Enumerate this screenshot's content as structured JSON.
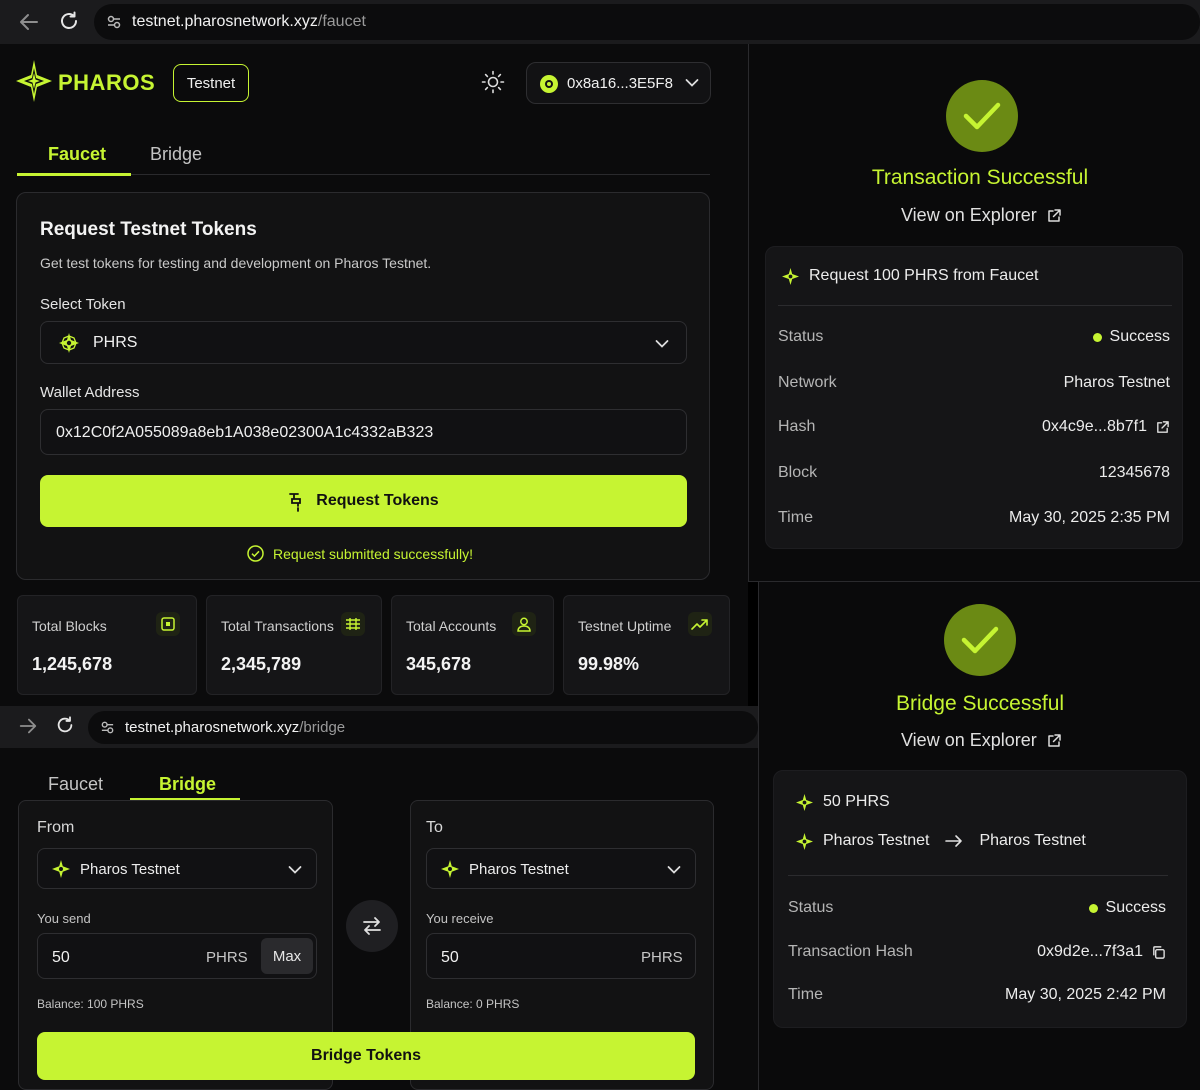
{
  "faucet_browser": {
    "url_host": "testnet.pharosnetwork.xyz",
    "url_path": "/faucet"
  },
  "header": {
    "brand": "PHAROS",
    "network_badge": "Testnet",
    "wallet_address": "0x8a16...3E5F8"
  },
  "faucet_tabs": {
    "faucet": "Faucet",
    "bridge": "Bridge",
    "active": "Faucet"
  },
  "request_card": {
    "title": "Request Testnet Tokens",
    "subtitle": "Get test tokens for testing and development on Pharos Testnet.",
    "select_label": "Select Token",
    "selected_token": "PHRS",
    "wallet_label": "Wallet Address",
    "wallet_value": "0x12C0f2A055089a8eb1A038e02300A1c4332aB323",
    "button_label": "Request Tokens",
    "success_message": "Request submitted successfully!"
  },
  "stats": [
    {
      "label": "Total Blocks",
      "value": "1,245,678",
      "icon": "block-icon"
    },
    {
      "label": "Total Transactions",
      "value": "2,345,789",
      "icon": "transactions-icon"
    },
    {
      "label": "Total Accounts",
      "value": "345,678",
      "icon": "user-icon"
    },
    {
      "label": "Testnet Uptime",
      "value": "99.98%",
      "icon": "trend-up-icon"
    }
  ],
  "tx_modal": {
    "title": "Transaction Successful",
    "explorer_link": "View on Explorer",
    "summary": "Request 100 PHRS from Faucet",
    "rows": [
      {
        "key": "Status",
        "value": "Success"
      },
      {
        "key": "Network",
        "value": "Pharos Testnet"
      },
      {
        "key": "Hash",
        "value": "0x4c9e...8b7f1"
      },
      {
        "key": "Block",
        "value": "12345678"
      },
      {
        "key": "Time",
        "value": "May 30, 2025 2:35 PM"
      }
    ]
  },
  "bridge_browser": {
    "url_host": "testnet.pharosnetwork.xyz",
    "url_path": "/bridge"
  },
  "bridge_tabs": {
    "faucet": "Faucet",
    "bridge": "Bridge",
    "active": "Bridge"
  },
  "bridge_form": {
    "from_label": "From",
    "from_network": "Pharos Testnet",
    "you_send_label": "You send",
    "send_amount": "50",
    "send_unit": "PHRS",
    "max_label": "Max",
    "send_balance": "Balance: 100 PHRS",
    "to_label": "To",
    "to_network": "Pharos Testnet",
    "you_receive_label": "You receive",
    "receive_amount": "50",
    "receive_unit": "PHRS",
    "receive_balance": "Balance: 0 PHRS",
    "button_label": "Bridge Tokens"
  },
  "bridge_modal": {
    "title": "Bridge Successful",
    "explorer_link": "View on Explorer",
    "amount": "50 PHRS",
    "route_from": "Pharos Testnet",
    "route_to": "Pharos Testnet",
    "rows": [
      {
        "key": "Status",
        "value": "Success"
      },
      {
        "key": "Transaction Hash",
        "value": "0x9d2e...7f3a1"
      },
      {
        "key": "Time",
        "value": "May 30, 2025 2:42 PM"
      }
    ]
  },
  "colors": {
    "accent": "#c6f432",
    "background": "#000000",
    "card": "#121213"
  }
}
